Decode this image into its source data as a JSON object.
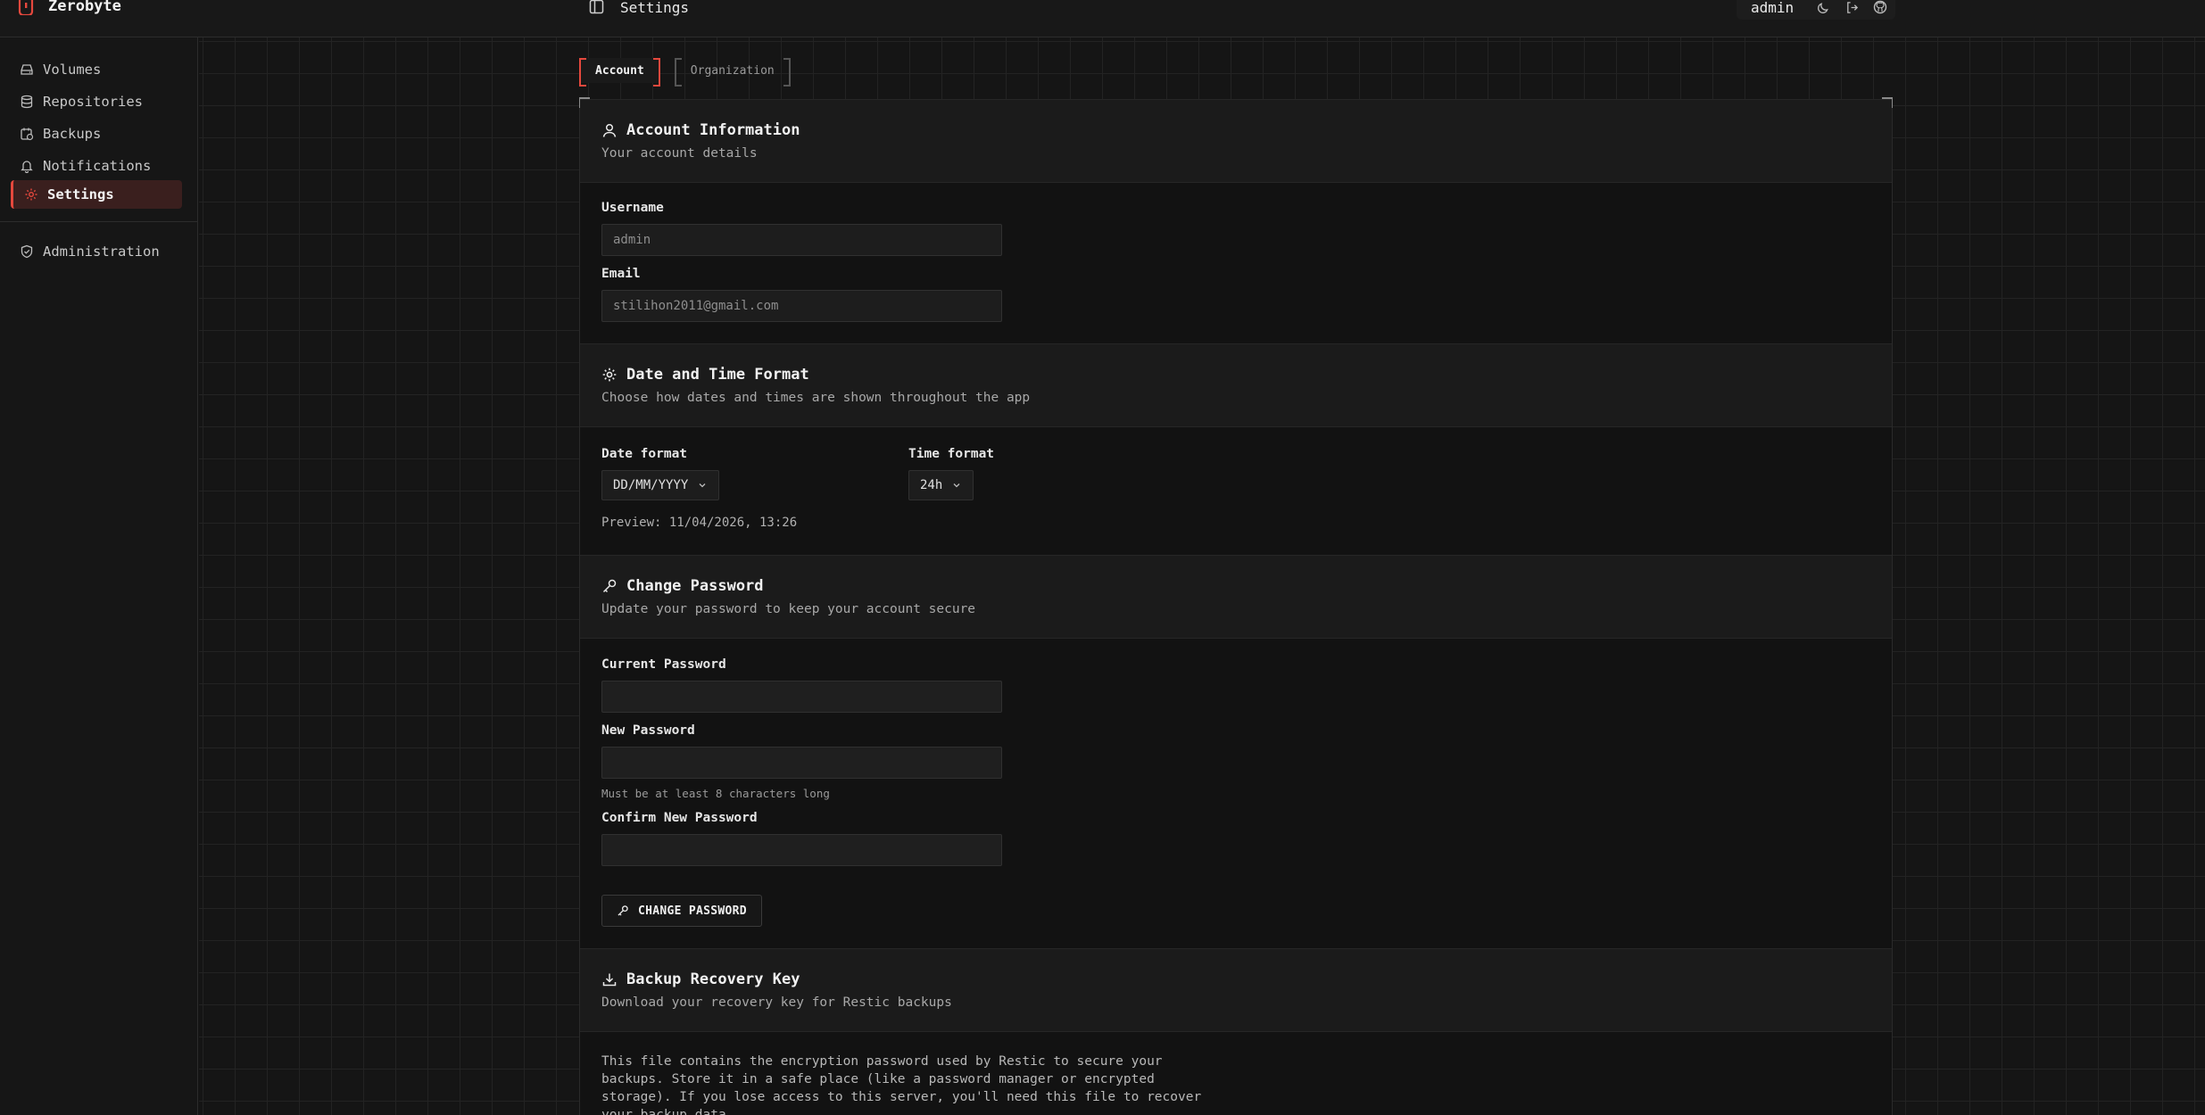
{
  "app": {
    "name": "Zerobyte"
  },
  "header": {
    "page_title": "Settings",
    "username": "admin"
  },
  "sidebar": {
    "items": [
      {
        "label": "Volumes",
        "icon": "hard-drive-icon"
      },
      {
        "label": "Repositories",
        "icon": "database-icon"
      },
      {
        "label": "Backups",
        "icon": "calendar-clock-icon"
      },
      {
        "label": "Notifications",
        "icon": "bell-icon"
      },
      {
        "label": "Settings",
        "icon": "gear-icon",
        "active": true
      }
    ],
    "admin_item": {
      "label": "Administration",
      "icon": "shield-check-icon"
    }
  },
  "tabs": [
    {
      "label": "Account",
      "active": true
    },
    {
      "label": "Organization",
      "active": false
    }
  ],
  "account": {
    "title": "Account Information",
    "subtitle": "Your account details",
    "username_label": "Username",
    "username_value": "admin",
    "email_label": "Email",
    "email_value": "stilihon2011@gmail.com"
  },
  "datetime": {
    "title": "Date and Time Format",
    "subtitle": "Choose how dates and times are shown throughout the app",
    "date_label": "Date format",
    "date_value": "DD/MM/YYYY",
    "time_label": "Time format",
    "time_value": "24h",
    "preview": "Preview: 11/04/2026, 13:26"
  },
  "password": {
    "title": "Change Password",
    "subtitle": "Update your password to keep your account secure",
    "current_label": "Current Password",
    "new_label": "New Password",
    "new_hint": "Must be at least 8 characters long",
    "confirm_label": "Confirm New Password",
    "button_label": "CHANGE PASSWORD"
  },
  "recovery": {
    "title": "Backup Recovery Key",
    "subtitle": "Download your recovery key for Restic backups",
    "description": "This file contains the encryption password used by Restic to secure your backups. Store it in a safe place (like a password manager or encrypted storage). If you lose access to this server, you'll need this file to recover your backup data."
  },
  "colors": {
    "accent": "#e5483d",
    "background": "#151515",
    "card": "#121212"
  }
}
